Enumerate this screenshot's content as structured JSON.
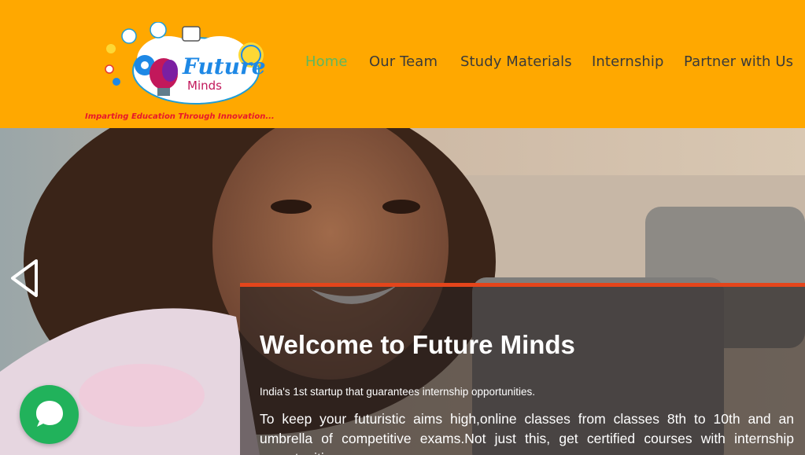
{
  "header": {
    "logo": {
      "wordmark_top": "Future",
      "wordmark_bottom": "Minds",
      "tagline": "Imparting Education Through Innovation..."
    },
    "nav": [
      {
        "label": "Home",
        "active": true
      },
      {
        "label": "Our Team",
        "active": false
      },
      {
        "label": "Study Materials",
        "active": false
      },
      {
        "label": "Internship",
        "active": false
      },
      {
        "label": "Partner with Us",
        "active": false
      }
    ]
  },
  "hero": {
    "title": "Welcome to Future Minds",
    "subtitle": "India's 1st startup that guarantees internship opportunities.",
    "body": "To keep your futuristic aims high,online classes from classes 8th to 10th and an umbrella of competitive exams.Not just this, get certified courses with internship opportunities."
  },
  "icons": {
    "prev": "chevron-left-icon",
    "chat": "chat-bubble-icon"
  },
  "colors": {
    "header_bg": "#FFA800",
    "nav_active": "#5FB85F",
    "nav_text": "#3a3a3a",
    "caption_accent": "#E4451B",
    "tagline": "#E8172B",
    "chat_bg": "#21B25B"
  }
}
